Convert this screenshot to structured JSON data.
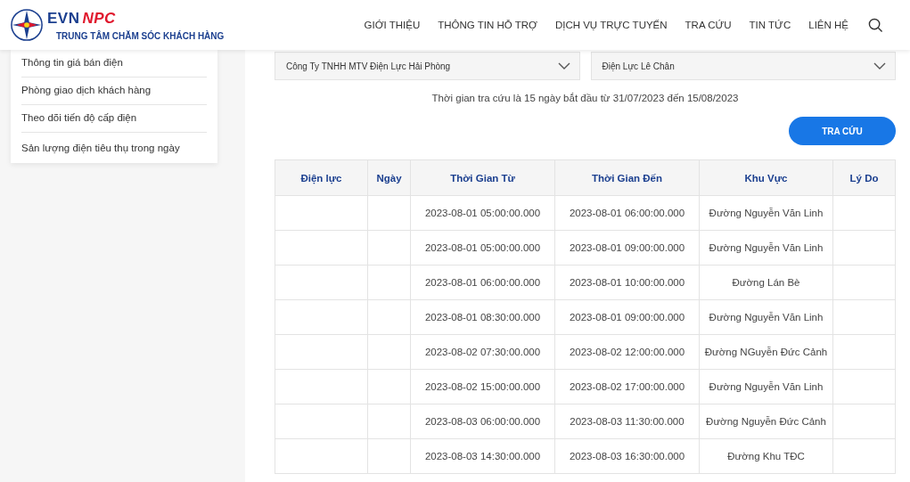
{
  "header": {
    "logo": {
      "brand_main": "EVN",
      "brand_accent": "NPC",
      "subtitle": "TRUNG TÂM CHĂM SÓC KHÁCH HÀNG"
    },
    "nav": [
      "GIỚI THIỆU",
      "THÔNG TIN HỖ TRỢ",
      "DỊCH VỤ TRỰC TUYẾN",
      "TRA CỨU",
      "TIN TỨC",
      "LIÊN HỆ"
    ]
  },
  "sidebar": {
    "items": [
      "Thông tin giá bán điện",
      "Phòng giao dịch khách hàng",
      "Theo dõi tiến độ cấp điện",
      "Sản lượng điện tiêu thụ trong ngày"
    ]
  },
  "filters": [
    {
      "value": "Công Ty TNHH MTV Điện Lực Hải Phòng"
    },
    {
      "value": "Điện Lực Lê Chân"
    }
  ],
  "notice": "Thời gian tra cứu là 15 ngày bắt đầu từ 31/07/2023 đến 15/08/2023",
  "search_button": "TRA CỨU",
  "table": {
    "columns": [
      "Điện lực",
      "Ngày",
      "Thời Gian Từ",
      "Thời Gian Đến",
      "Khu Vực",
      "Lý Do"
    ],
    "rows": [
      [
        "",
        "",
        "2023-08-01 05:00:00.000",
        "2023-08-01 06:00:00.000",
        "Đường Nguyễn Văn Linh",
        ""
      ],
      [
        "",
        "",
        "2023-08-01 05:00:00.000",
        "2023-08-01 09:00:00.000",
        "Đường Nguyễn Văn Linh",
        ""
      ],
      [
        "",
        "",
        "2023-08-01 06:00:00.000",
        "2023-08-01 10:00:00.000",
        "Đường Lán Bè",
        ""
      ],
      [
        "",
        "",
        "2023-08-01 08:30:00.000",
        "2023-08-01 09:00:00.000",
        "Đường Nguyễn Văn Linh",
        ""
      ],
      [
        "",
        "",
        "2023-08-02 07:30:00.000",
        "2023-08-02 12:00:00.000",
        "Đường NGuyễn Đức Cảnh",
        ""
      ],
      [
        "",
        "",
        "2023-08-02 15:00:00.000",
        "2023-08-02 17:00:00.000",
        "Đường Nguyễn Văn Linh",
        ""
      ],
      [
        "",
        "",
        "2023-08-03 06:00:00.000",
        "2023-08-03 11:30:00.000",
        "Đường Nguyễn Đức Cảnh",
        ""
      ],
      [
        "",
        "",
        "2023-08-03 14:30:00.000",
        "2023-08-03 16:30:00.000",
        "Đường Khu TĐC",
        ""
      ]
    ]
  }
}
